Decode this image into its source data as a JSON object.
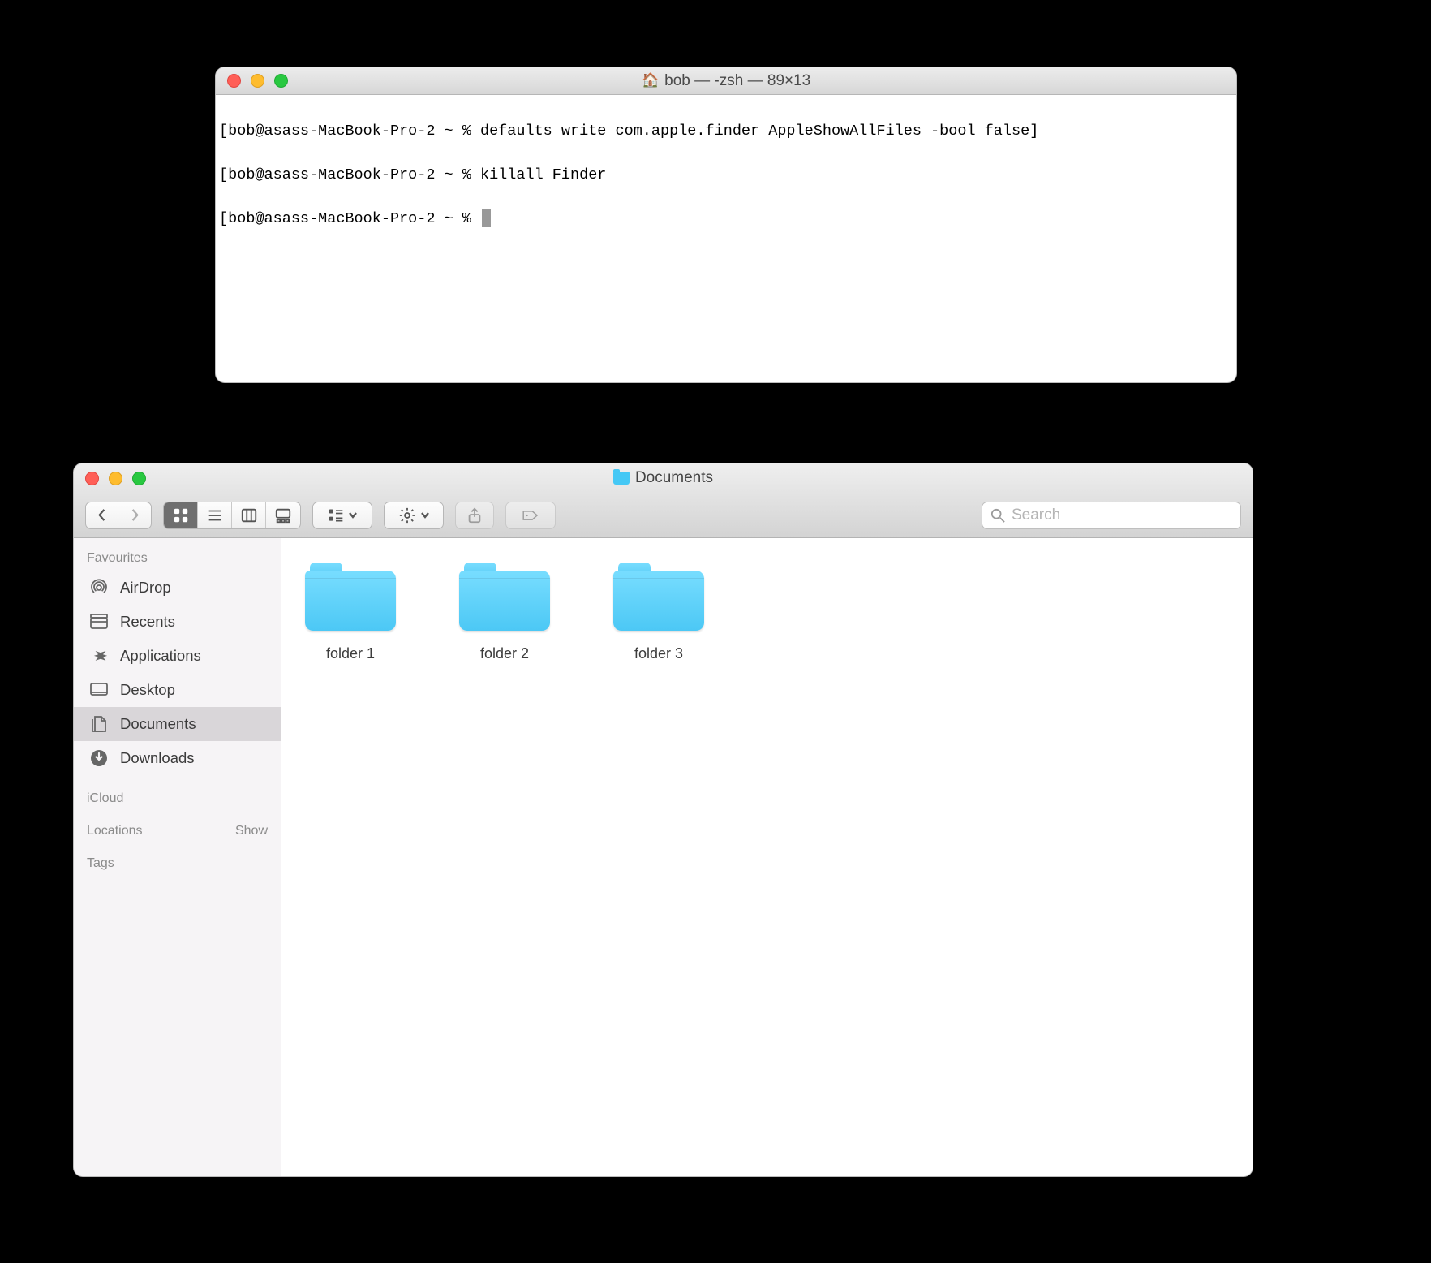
{
  "terminal": {
    "title": "bob — -zsh — 89×13",
    "prompt": "bob@asass-MacBook-Pro-2 ~ % ",
    "lines": [
      {
        "cmd": "defaults write com.apple.finder AppleShowAllFiles -bool false"
      },
      {
        "cmd": "killall Finder"
      },
      {
        "cmd": ""
      }
    ]
  },
  "finder": {
    "title": "Documents",
    "search_placeholder": "Search",
    "sidebar": {
      "favourites_label": "Favourites",
      "icloud_label": "iCloud",
      "locations_label": "Locations",
      "locations_show": "Show",
      "tags_label": "Tags",
      "items": [
        {
          "label": "AirDrop",
          "icon": "airdrop"
        },
        {
          "label": "Recents",
          "icon": "recents"
        },
        {
          "label": "Applications",
          "icon": "apps"
        },
        {
          "label": "Desktop",
          "icon": "desktop"
        },
        {
          "label": "Documents",
          "icon": "documents",
          "selected": true
        },
        {
          "label": "Downloads",
          "icon": "downloads"
        }
      ]
    },
    "folders": [
      {
        "name": "folder 1"
      },
      {
        "name": "folder 2"
      },
      {
        "name": "folder 3"
      }
    ]
  }
}
